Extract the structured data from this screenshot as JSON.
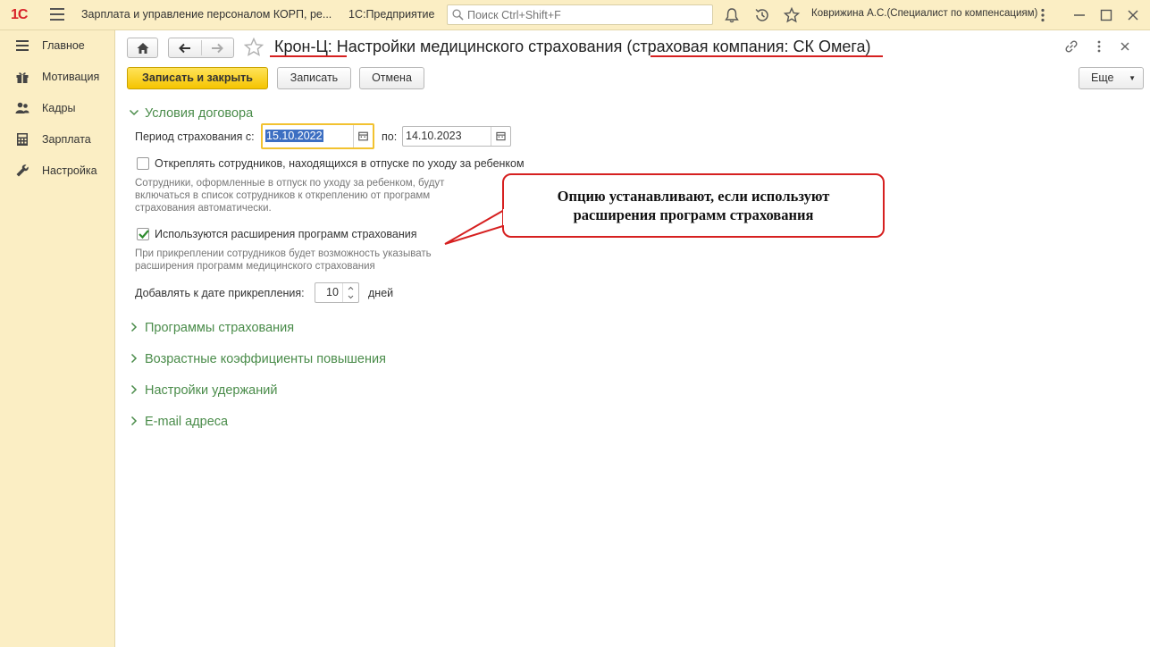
{
  "app": {
    "logo_text": "1С",
    "title": "Зарплата и управление персоналом КОРП, ре...",
    "platform": "1С:Предприятие",
    "search_placeholder": "Поиск Ctrl+Shift+F",
    "user": "Коврижина А.С.(Специалист по компенсациям)"
  },
  "sidebar": {
    "items": [
      {
        "label": "Главное",
        "icon": "menu-lines-icon"
      },
      {
        "label": "Мотивация",
        "icon": "gift-icon"
      },
      {
        "label": "Кадры",
        "icon": "people-icon"
      },
      {
        "label": "Зарплата",
        "icon": "calculator-icon"
      },
      {
        "label": "Настройка",
        "icon": "wrench-icon"
      }
    ]
  },
  "form": {
    "title": "Крон-Ц: Настройки медицинского страхования (страховая компания: СК Омега)",
    "buttons": {
      "save_close": "Записать и закрыть",
      "save": "Записать",
      "cancel": "Отмена",
      "more": "Еще"
    },
    "sections": {
      "contract": "Условия договора",
      "programs": "Программы страхования",
      "age_coef": "Возрастные коэффициенты повышения",
      "deductions": "Настройки удержаний",
      "emails": "E-mail адреса"
    },
    "period_label": "Период страхования с:",
    "period_from": "15.10.2022",
    "period_to_label": "по:",
    "period_to": "14.10.2023",
    "detach_checkbox_label": "Откреплять сотрудников, находящихся в отпуске по уходу за ребенком",
    "detach_checked": false,
    "detach_hint_1": "Сотрудники, оформленные в отпуск по уходу за ребенком, будут",
    "detach_hint_2": "включаться в список сотрудников к откреплению от программ",
    "detach_hint_3": "страхования автоматически.",
    "extensions_checkbox_label": "Используются расширения программ страхования",
    "extensions_checked": true,
    "extensions_hint_1": "При прикреплении сотрудников будет возможность указывать",
    "extensions_hint_2": "расширения программ медицинского страхования",
    "add_days_label": "Добавлять к дате прикрепления:",
    "add_days_value": "10",
    "add_days_unit": "дней"
  },
  "callout": {
    "line1": "Опцию устанавливают, если используют",
    "line2": "расширения программ страхования"
  },
  "colors": {
    "topbar": "#fbeec4",
    "accent_green": "#4a8c4a",
    "primary_button": "#f5c400",
    "annotation_red": "#d62020"
  }
}
